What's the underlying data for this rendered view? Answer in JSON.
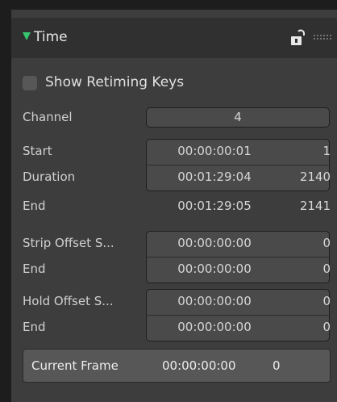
{
  "panel": {
    "title": "Time",
    "accent_color": "#37c46e"
  },
  "show_retiming_keys": {
    "label": "Show Retiming Keys",
    "checked": false
  },
  "channel": {
    "label": "Channel",
    "value": "4"
  },
  "timing": {
    "start": {
      "label": "Start",
      "timecode": "00:00:00:01",
      "frame": "1"
    },
    "duration": {
      "label": "Duration",
      "timecode": "00:01:29:04",
      "frame": "2140"
    },
    "end": {
      "label": "End",
      "timecode": "00:01:29:05",
      "frame": "2141"
    }
  },
  "strip_offset": {
    "start": {
      "label": "Strip Offset S...",
      "timecode": "00:00:00:00",
      "frame": "0"
    },
    "end": {
      "label": "End",
      "timecode": "00:00:00:00",
      "frame": "0"
    }
  },
  "hold_offset": {
    "start": {
      "label": "Hold Offset S...",
      "timecode": "00:00:00:00",
      "frame": "0"
    },
    "end": {
      "label": "End",
      "timecode": "00:00:00:00",
      "frame": "0"
    }
  },
  "current_frame": {
    "label": "Current Frame",
    "timecode": "00:00:00:00",
    "frame": "0"
  },
  "icons": {
    "collapse": "triangle-down-icon",
    "lock": "unlocked-icon",
    "drag": "drag-handle-icon"
  }
}
